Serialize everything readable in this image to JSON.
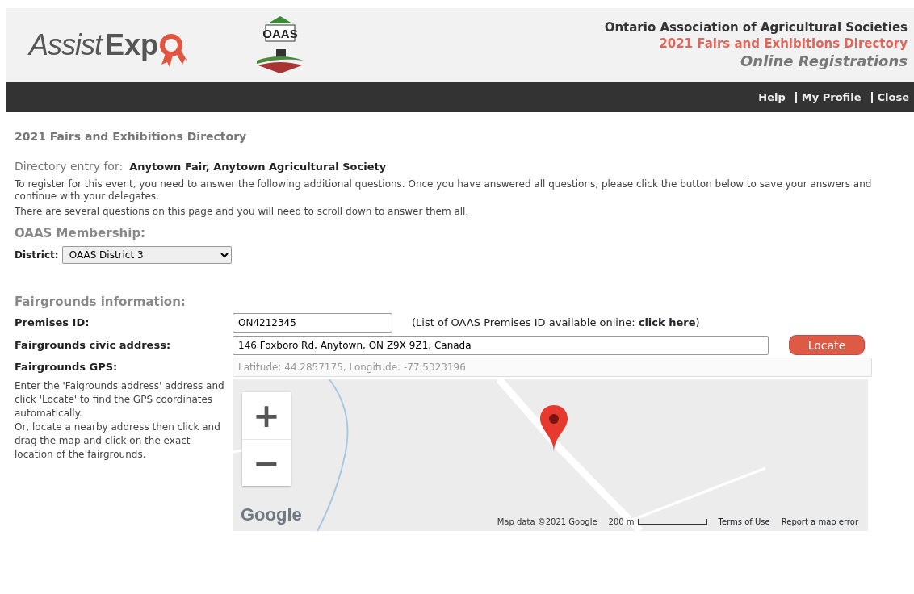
{
  "header": {
    "logo_light": "Assist",
    "logo_bold": "Exp",
    "partner_logo": "OAAS",
    "org": "Ontario Association of Agricultural Societies",
    "directory": "2021 Fairs and Exhibitions Directory",
    "subtitle": "Online Registrations"
  },
  "nav": [
    {
      "label": "Help"
    },
    {
      "label": "My Profile"
    },
    {
      "label": "Close"
    }
  ],
  "page_title": "2021 Fairs and Exhibitions Directory",
  "entry": {
    "label": "Directory entry for:",
    "value": "Anytown Fair, Anytown Agricultural Society"
  },
  "intro": [
    "To register for this event, you need to answer the following additional questions. Once you have answered all questions, please click the button below to save your answers and continue with your delegates.",
    "There are several questions on this page and you will need to scroll down to answer them all."
  ],
  "membership": {
    "heading": "OAAS Membership:",
    "label": "District:",
    "value": "OAAS District 3"
  },
  "fairgrounds": {
    "heading": "Fairgrounds information:",
    "premises": {
      "label": "Premises ID:",
      "value": "ON4212345",
      "note_before": "(List of OAAS Premises ID available online: ",
      "link": "click here",
      "note_after": ")"
    },
    "address": {
      "label": "Fairgrounds civic address:",
      "value": "146 Foxboro Rd, Anytown, ON Z9X 9Z1, Canada",
      "button": "Locate"
    },
    "gps": {
      "label": "Fairgrounds GPS:",
      "value": "Latitude: 44.2857175, Longitude: -77.5323196",
      "disabled": true
    },
    "help": [
      "Enter the 'Faigrounds address' address and click 'Locate' to find the GPS coordinates automatically.",
      "Or, locate a nearby address then click and drag the map and click on the exact location of the fairgrounds."
    ],
    "map": {
      "zoom_in": "+",
      "zoom_out": "−",
      "brand": "Google",
      "attribution": "Map data ©2021 Google",
      "scale": "200 m",
      "terms": "Terms of Use",
      "report": "Report a map error"
    }
  }
}
